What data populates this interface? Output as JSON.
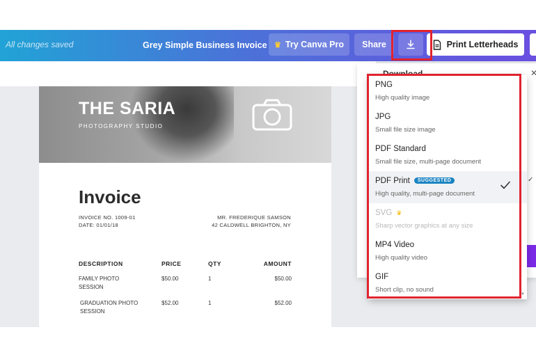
{
  "toolbar": {
    "status": "All changes saved",
    "doc_title": "Grey Simple Business Invoice",
    "try_pro_label": "Try Canva Pro",
    "share_label": "Share",
    "print_label": "Print Letterheads",
    "download_icon": "download-icon",
    "print_icon": "document-icon",
    "crown_icon": "crown-icon"
  },
  "invoice": {
    "brand": "THE SARIA",
    "tagline": "PHOTOGRAPHY STUDIO",
    "title": "Invoice",
    "invoice_no": "INVOICE NO. 1009-01",
    "date": "DATE: 01/01/18",
    "client_name": "MR. FREDERIQUE SAMSON",
    "client_address": "42 CALDWELL BRIGHTON, NY",
    "table": {
      "headers": [
        "DESCRIPTION",
        "PRICE",
        "QTY",
        "AMOUNT"
      ],
      "rows": [
        {
          "description_1": "FAMILY PHOTO",
          "description_2": "SESSION",
          "price": "$50.00",
          "qty": "1",
          "amount": "$50.00"
        },
        {
          "description_1": "GRADUATION PHOTO",
          "description_2": "SESSION",
          "price": "$52.00",
          "qty": "1",
          "amount": "$52.00"
        }
      ]
    }
  },
  "download_panel": {
    "title": "Download",
    "formats": [
      {
        "name": "PNG",
        "description": "High quality image"
      },
      {
        "name": "JPG",
        "description": "Small file size image"
      },
      {
        "name": "PDF Standard",
        "description": "Small file size, multi-page document"
      },
      {
        "name": "PDF Print",
        "badge": "SUGGESTED",
        "description": "High quality, multi-page document",
        "selected": true
      },
      {
        "name": "SVG",
        "description": "Sharp vector graphics at any size",
        "disabled": true,
        "pro": true
      },
      {
        "name": "MP4 Video",
        "description": "High quality video"
      },
      {
        "name": "GIF",
        "description": "Short clip, no sound"
      }
    ]
  },
  "colors": {
    "highlight": "#e0232f",
    "badge": "#1b84c2",
    "toolbar_start": "#21a3d6",
    "toolbar_end": "#6a4fe0"
  }
}
